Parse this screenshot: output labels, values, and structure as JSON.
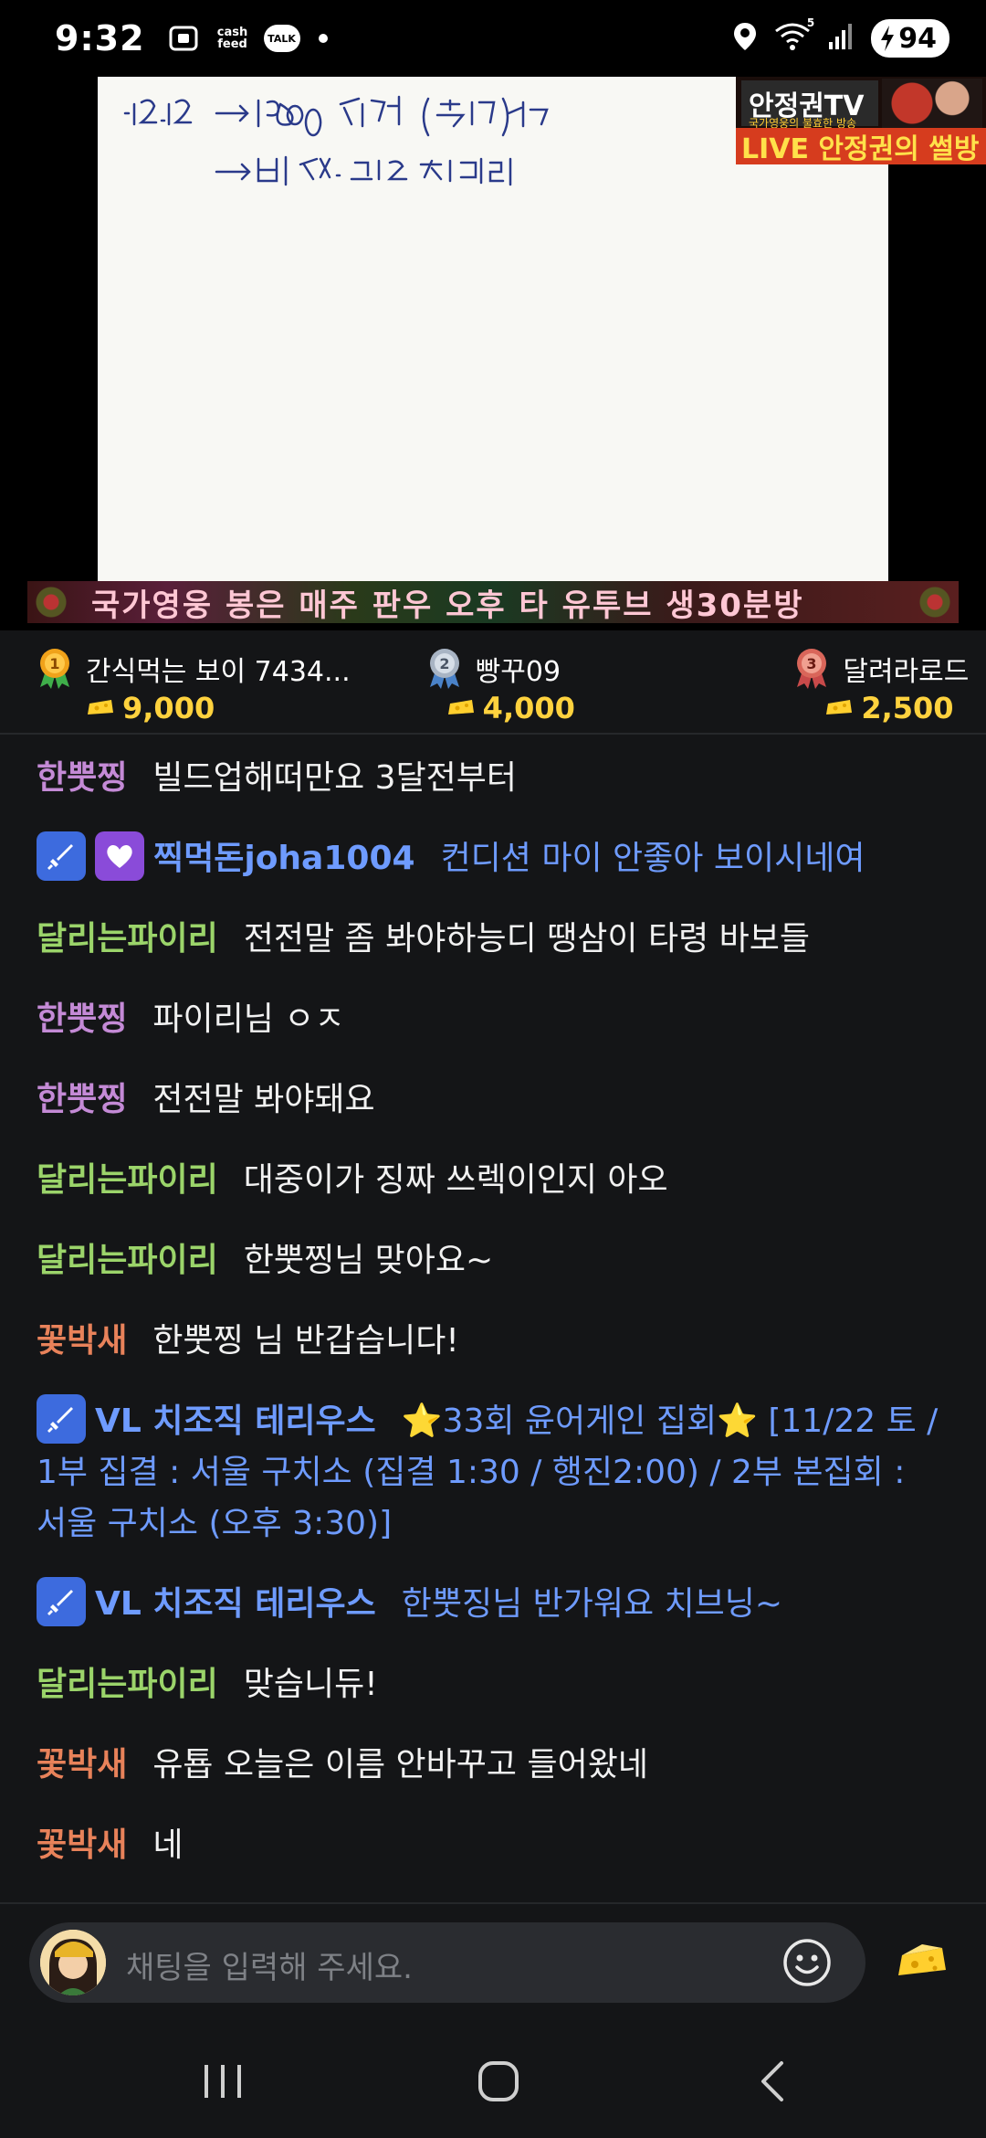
{
  "status_bar": {
    "time": "9:32",
    "cash_feed_top": "cash",
    "cash_feed_bottom": "feed",
    "talk_label": "TALK",
    "wifi_label": "5",
    "battery": "94"
  },
  "video": {
    "channel_name": "안정권TV",
    "channel_sub": "국가영웅의 불효한 방송",
    "live_banner": "LIVE 안정권의 썰방",
    "ticker_text": "국가영웅 봉은 매주 판우 오후 타 유투브 생30분방"
  },
  "ranking": [
    {
      "rank": "1",
      "name": "간식먹는 보이 7434...",
      "score": "9,000",
      "color": "#f0a21a"
    },
    {
      "rank": "2",
      "name": "빵꾸09",
      "score": "4,000",
      "color": "#a8b4c4"
    },
    {
      "rank": "3",
      "name": "달려라로드",
      "score": "2,500",
      "color": "#d9665a"
    }
  ],
  "chat": [
    {
      "nick": "한뿟찡",
      "nick_color": "#c48ad6",
      "text": "빌드업해떠만요 3달전부터",
      "badges": []
    },
    {
      "nick": "찍먹돈joha1004",
      "nick_color": "#6e9bff",
      "text": "컨디션 마이 안좋아 보이시네여",
      "badges": [
        "sword-icon",
        "heart-icon"
      ],
      "text_blue": true
    },
    {
      "nick": "달리는파이리",
      "nick_color": "#9bd46a",
      "text": "전전말 좀 봐야하능디 땡삼이 타령 바보들",
      "badges": []
    },
    {
      "nick": "한뿟찡",
      "nick_color": "#c48ad6",
      "text": "파이리님 ㅇㅈ",
      "badges": []
    },
    {
      "nick": "한뿟찡",
      "nick_color": "#c48ad6",
      "text": "전전말 봐야돼요",
      "badges": []
    },
    {
      "nick": "달리는파이리",
      "nick_color": "#9bd46a",
      "text": "대중이가 징짜 쓰렉이인지 아오",
      "badges": []
    },
    {
      "nick": "달리는파이리",
      "nick_color": "#9bd46a",
      "text": "한뿟찡님 맞아요~",
      "badges": []
    },
    {
      "nick": "꽃박새",
      "nick_color": "#e8825a",
      "text": "한뿟찡 님 반갑습니다!",
      "badges": []
    },
    {
      "nick": "VL 치조직 테리우스",
      "nick_color": "#6e9bff",
      "text": "⭐33회 윤어게인 집회⭐ [11/22 토 / 1부 집결 : 서울 구치소 (집결 1:30 / 행진2:00) / 2부 본집회 : 서울 구치소 (오후 3:30)]",
      "badges": [
        "sword-icon"
      ],
      "text_blue": true
    },
    {
      "nick": "VL 치조직 테리우스",
      "nick_color": "#6e9bff",
      "text": "한뿟징님 반가워요 치브닝~",
      "badges": [
        "sword-icon"
      ],
      "text_blue": true
    },
    {
      "nick": "달리는파이리",
      "nick_color": "#9bd46a",
      "text": "맞습니듀!",
      "badges": []
    },
    {
      "nick": "꽃박새",
      "nick_color": "#e8825a",
      "text": "유툡 오늘은 이름 안바꾸고 들어왔네",
      "badges": []
    },
    {
      "nick": "꽃박새",
      "nick_color": "#e8825a",
      "text": "네",
      "badges": []
    }
  ],
  "input": {
    "placeholder": "채팅을 입력해 주세요."
  },
  "nav": {
    "recent": "recent-apps-icon",
    "home": "home-icon",
    "back": "back-icon"
  }
}
